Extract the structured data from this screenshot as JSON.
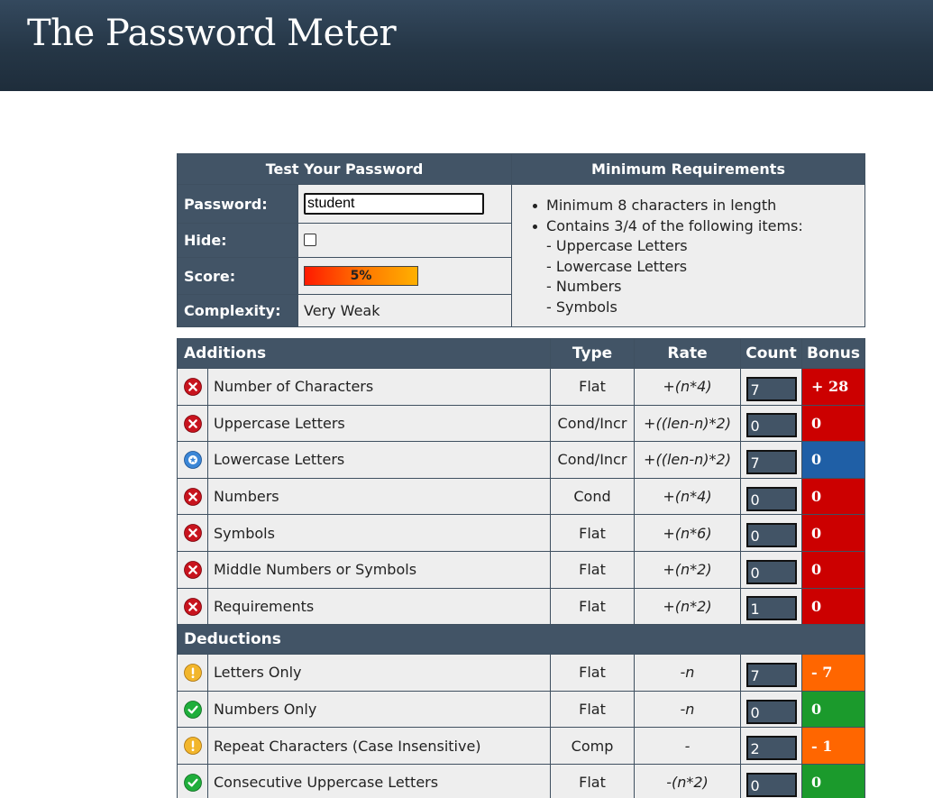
{
  "header": {
    "title": "The Password Meter"
  },
  "test": {
    "heading": "Test Your Password",
    "password_label": "Password:",
    "password_value": "student",
    "hide_label": "Hide:",
    "score_label": "Score:",
    "score_value": "5%",
    "complexity_label": "Complexity:",
    "complexity_value": "Very Weak"
  },
  "requirements": {
    "heading": "Minimum Requirements",
    "items": [
      "Minimum 8 characters in length",
      "Contains 3/4 of the following items:",
      "- Uppercase Letters",
      "- Lowercase Letters",
      "- Numbers",
      "- Symbols"
    ]
  },
  "columns": {
    "additions": "Additions",
    "type": "Type",
    "rate": "Rate",
    "count": "Count",
    "bonus": "Bonus",
    "deductions": "Deductions"
  },
  "colors": {
    "fail": "#cc0000",
    "exceptional": "#1f5fa6",
    "warn": "#ff6600",
    "pass": "#1b9a2c"
  },
  "additions": [
    {
      "icon": "fail-x-icon",
      "name": "Number of Characters",
      "type": "Flat",
      "rate": "+(n*4)",
      "count": "7",
      "bonus": "+ 28",
      "status": "fail"
    },
    {
      "icon": "fail-x-icon",
      "name": "Uppercase Letters",
      "type": "Cond/Incr",
      "rate": "+((len-n)*2)",
      "count": "0",
      "bonus": "0",
      "status": "fail"
    },
    {
      "icon": "exceptional-star-icon",
      "name": "Lowercase Letters",
      "type": "Cond/Incr",
      "rate": "+((len-n)*2)",
      "count": "7",
      "bonus": "0",
      "status": "exceptional"
    },
    {
      "icon": "fail-x-icon",
      "name": "Numbers",
      "type": "Cond",
      "rate": "+(n*4)",
      "count": "0",
      "bonus": "0",
      "status": "fail"
    },
    {
      "icon": "fail-x-icon",
      "name": "Symbols",
      "type": "Flat",
      "rate": "+(n*6)",
      "count": "0",
      "bonus": "0",
      "status": "fail"
    },
    {
      "icon": "fail-x-icon",
      "name": "Middle Numbers or Symbols",
      "type": "Flat",
      "rate": "+(n*2)",
      "count": "0",
      "bonus": "0",
      "status": "fail"
    },
    {
      "icon": "fail-x-icon",
      "name": "Requirements",
      "type": "Flat",
      "rate": "+(n*2)",
      "count": "1",
      "bonus": "0",
      "status": "fail"
    }
  ],
  "deductions": [
    {
      "icon": "warning-icon",
      "name": "Letters Only",
      "type": "Flat",
      "rate": "-n",
      "count": "7",
      "bonus": "- 7",
      "status": "warn"
    },
    {
      "icon": "pass-check-icon",
      "name": "Numbers Only",
      "type": "Flat",
      "rate": "-n",
      "count": "0",
      "bonus": "0",
      "status": "pass"
    },
    {
      "icon": "warning-icon",
      "name": "Repeat Characters (Case Insensitive)",
      "type": "Comp",
      "rate": "-",
      "count": "2",
      "bonus": "- 1",
      "status": "warn"
    },
    {
      "icon": "pass-check-icon",
      "name": "Consecutive Uppercase Letters",
      "type": "Flat",
      "rate": "-(n*2)",
      "count": "0",
      "bonus": "0",
      "status": "pass"
    }
  ]
}
